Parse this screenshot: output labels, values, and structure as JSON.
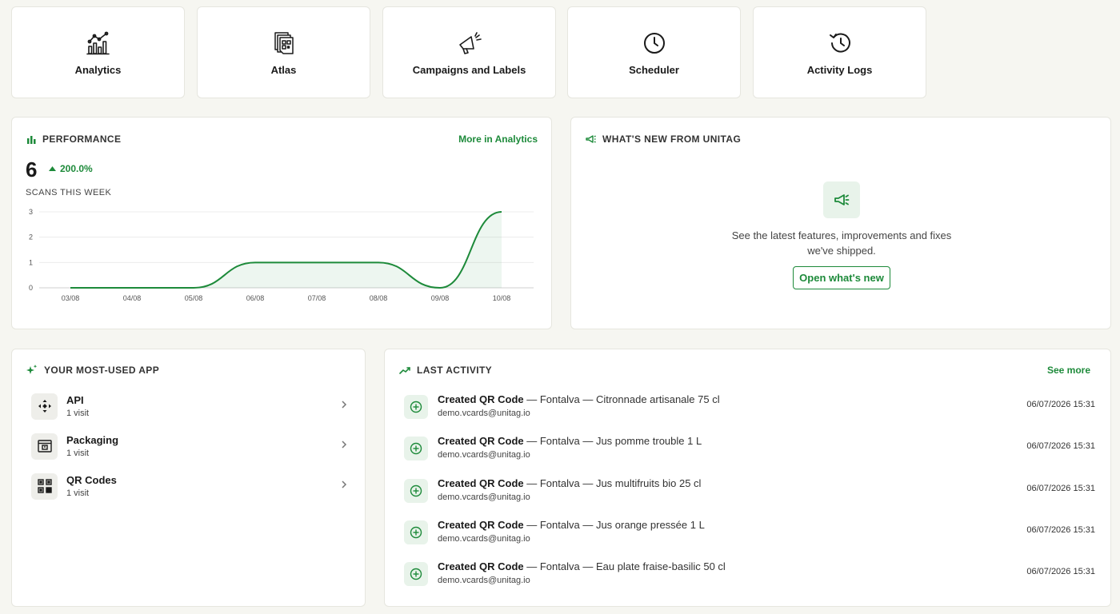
{
  "apps": [
    {
      "label": "Analytics",
      "icon": "analytics-icon"
    },
    {
      "label": "Atlas",
      "icon": "atlas-icon"
    },
    {
      "label": "Campaigns and Labels",
      "icon": "megaphone-icon"
    },
    {
      "label": "Scheduler",
      "icon": "clock-icon"
    },
    {
      "label": "Activity Logs",
      "icon": "history-icon"
    }
  ],
  "performance": {
    "title": "PERFORMANCE",
    "link": "More in Analytics",
    "value": "6",
    "delta": "200.0%",
    "subtitle": "SCANS THIS WEEK"
  },
  "chart_data": {
    "type": "area",
    "title": "",
    "xlabel": "",
    "ylabel": "",
    "categories": [
      "03/08",
      "04/08",
      "05/08",
      "06/08",
      "07/08",
      "08/08",
      "09/08",
      "10/08"
    ],
    "series": [
      {
        "values": [
          0,
          0,
          0,
          1,
          1,
          1,
          0,
          3
        ]
      }
    ],
    "ylim": [
      0,
      3
    ],
    "yticks": [
      "0",
      "1",
      "2",
      "3"
    ],
    "grid": true,
    "color": "#1d8a3a"
  },
  "news": {
    "title": "WHAT'S NEW FROM UNITAG",
    "text": "See the latest features, improvements and fixes we've shipped.",
    "button": "Open what's new"
  },
  "most_used": {
    "title": "YOUR MOST-USED APP",
    "items": [
      {
        "name": "API",
        "visits": "1 visit",
        "icon": "api-icon"
      },
      {
        "name": "Packaging",
        "visits": "1 visit",
        "icon": "packaging-icon"
      },
      {
        "name": "QR Codes",
        "visits": "1 visit",
        "icon": "qr-code-icon"
      }
    ]
  },
  "activity": {
    "title": "LAST ACTIVITY",
    "link": "See more",
    "items": [
      {
        "action": "Created QR Code",
        "detail": " — Fontalva — Citronnade artisanale 75 cl",
        "email": "demo.vcards@unitag.io",
        "time": "06/07/2026 15:31"
      },
      {
        "action": "Created QR Code",
        "detail": " — Fontalva — Jus pomme trouble 1 L",
        "email": "demo.vcards@unitag.io",
        "time": "06/07/2026 15:31"
      },
      {
        "action": "Created QR Code",
        "detail": " — Fontalva — Jus multifruits bio 25 cl",
        "email": "demo.vcards@unitag.io",
        "time": "06/07/2026 15:31"
      },
      {
        "action": "Created QR Code",
        "detail": " — Fontalva — Jus orange pressée 1 L",
        "email": "demo.vcards@unitag.io",
        "time": "06/07/2026 15:31"
      },
      {
        "action": "Created QR Code",
        "detail": " — Fontalva — Eau plate fraise-basilic 50 cl",
        "email": "demo.vcards@unitag.io",
        "time": "06/07/2026 15:31"
      }
    ]
  },
  "colors": {
    "accent": "#1d8a3a",
    "background": "#f6f6f1"
  }
}
